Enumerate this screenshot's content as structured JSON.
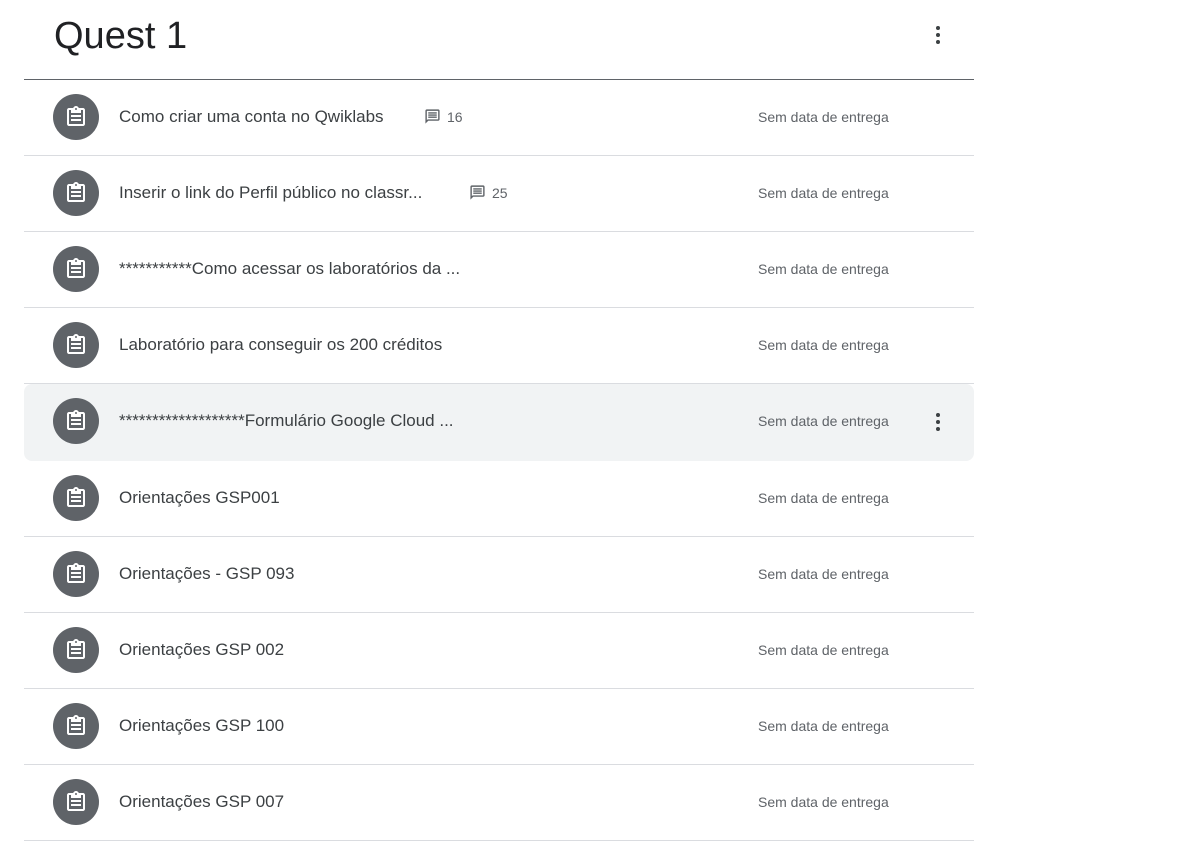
{
  "topic": {
    "title": "Quest 1"
  },
  "items": [
    {
      "title": "Como criar uma conta no Qwiklabs",
      "comments": "16",
      "due": "Sem data de entrega"
    },
    {
      "title": "Inserir o link do Perfil público no classr...",
      "comments": "25",
      "due": "Sem data de entrega"
    },
    {
      "title": "***********Como acessar os laboratórios da ...",
      "due": "Sem data de entrega"
    },
    {
      "title": "Laboratório para conseguir os 200 créditos",
      "due": "Sem data de entrega"
    },
    {
      "title": "*******************Formulário Google Cloud ...",
      "due": "Sem data de entrega",
      "hovered": true
    },
    {
      "title": "Orientações GSP001",
      "due": "Sem data de entrega"
    },
    {
      "title": "Orientações - GSP 093",
      "due": "Sem data de entrega"
    },
    {
      "title": "Orientações GSP 002",
      "due": "Sem data de entrega"
    },
    {
      "title": "Orientações GSP 100",
      "due": "Sem data de entrega"
    },
    {
      "title": "Orientações GSP 007",
      "due": "Sem data de entrega"
    }
  ],
  "icons": {
    "assignment": "assignment-icon",
    "comment": "comment-icon",
    "more": "more-vert-icon"
  },
  "colors": {
    "icon_bg": "#5f6368",
    "hover_bg": "#f1f3f4",
    "divider": "#dadce0"
  }
}
